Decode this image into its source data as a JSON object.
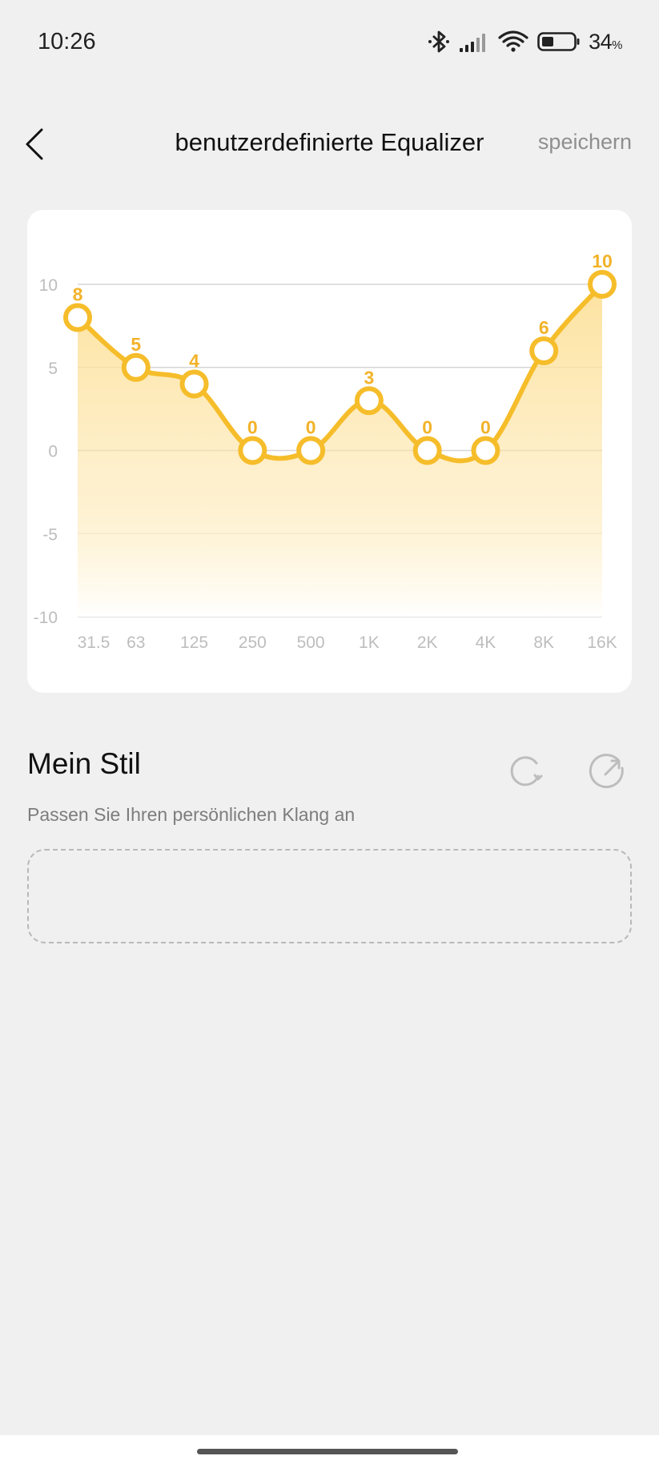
{
  "status_bar": {
    "time": "10:26",
    "battery_percent": "34",
    "battery_unit": "%",
    "icons": [
      "bluetooth-icon",
      "signal-icon",
      "wifi-icon",
      "battery-icon"
    ]
  },
  "header": {
    "back_icon": "chevron-left-icon",
    "title": "benutzerdefinierte Equalizer",
    "save_label": "speichern"
  },
  "chart_data": {
    "type": "area",
    "categories": [
      "31.5",
      "63",
      "125",
      "250",
      "500",
      "1K",
      "2K",
      "4K",
      "8K",
      "16K"
    ],
    "values": [
      8,
      5,
      4,
      0,
      0,
      3,
      0,
      0,
      6,
      10
    ],
    "ylim": [
      -10,
      10
    ],
    "yticks": [
      "10",
      "5",
      "0",
      "-5",
      "-10"
    ],
    "ytick_values": [
      10,
      5,
      0,
      -5,
      -10
    ],
    "grid": true,
    "colors": {
      "line": "#f6bd2b",
      "fill_top": "#fde3a1",
      "fill_bottom": "#ffffff",
      "grid": "#d6d6d6",
      "label": "#f2b32a",
      "tick": "#bdbdbd"
    }
  },
  "section": {
    "title": "Mein Stil",
    "subtitle": "Passen Sie Ihren persönlichen Klang an",
    "reset_icon": "reset-icon",
    "share_icon": "share-icon"
  }
}
